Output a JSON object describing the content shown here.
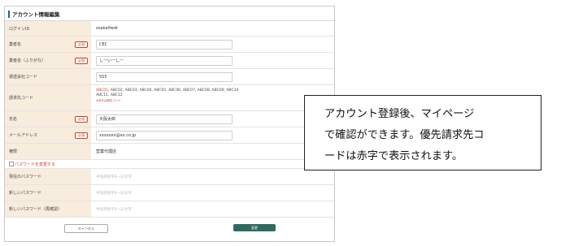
{
  "form": {
    "title": "アカウント情報編集",
    "required_badge": "必須",
    "rows": {
      "login_id": {
        "label": "ログインID",
        "value": "osakafiwdr"
      },
      "company_name": {
        "label": "業者名",
        "value": "CEC"
      },
      "company_kana": {
        "label": "業者名（ふりがな）",
        "value": "しーいーしー"
      },
      "transport_code": {
        "label": "運送会社コード",
        "value": "555"
      },
      "billing_code": {
        "label": "請求先コード",
        "primary": "ABC01",
        "line1_rest": ", ABC02, ABC03, ABC04, ABC05, ABC06, ABC07, ABC08, ABC09, ABC10",
        "line2": "ABC11, ABC12",
        "note": "※赤字は優先コード"
      },
      "name": {
        "label": "氏名",
        "value": "大阪太郎"
      },
      "email": {
        "label": "メールアドレス",
        "value": "xxxxxxx@xx.co.jp"
      },
      "role": {
        "label": "権限",
        "value": "营業代理店"
      }
    },
    "password_change": "パスワードを変更する",
    "password_rows": {
      "current": {
        "label": "現在のパスワード",
        "placeholder": "半角英数字8~32文字"
      },
      "new": {
        "label": "新しいパスワード",
        "placeholder": "半角英数字8~32文字"
      },
      "confirm": {
        "label": "新しいパスワード（再確認）",
        "placeholder": "半角英数字8~32文字"
      }
    },
    "buttons": {
      "cancel": "キャンセル",
      "submit": "変更"
    }
  },
  "callout": {
    "line1": "アカウント登録後、マイページ",
    "line2": "で確認ができます。優先請求先コ",
    "line3": "ードは赤字で表示されます。"
  },
  "colors": {
    "label_bg": "#f8ecdd",
    "required": "#d23b2a",
    "submit_bg": "#2f6a60",
    "title_bar": "#2d5b8c"
  }
}
